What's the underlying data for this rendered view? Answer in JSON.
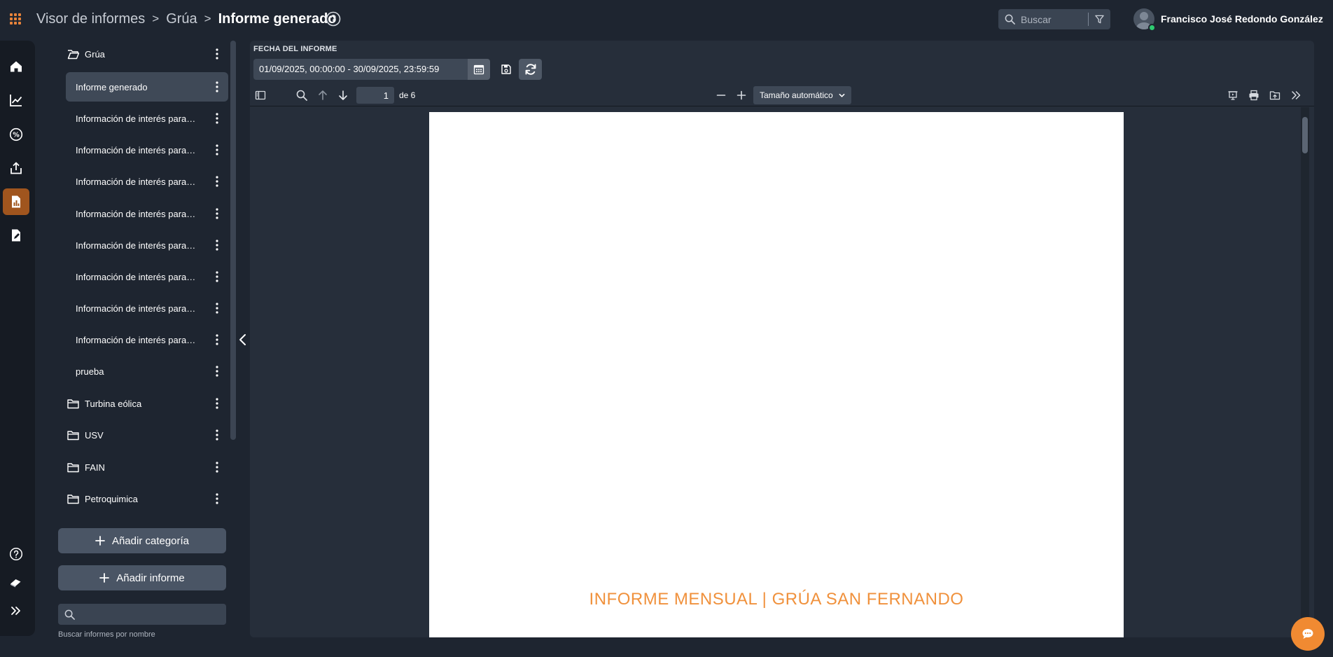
{
  "header": {
    "breadcrumb": [
      "Visor de informes",
      "Grúa",
      "Informe generado"
    ],
    "breadcrumb_separator": ">",
    "search_placeholder": "Buscar",
    "user_name": "Francisco José Redondo González"
  },
  "rail": {
    "active_index": 4,
    "icons": [
      "home-icon",
      "line-chart-icon",
      "percent-icon",
      "export-icon",
      "report-icon",
      "edit-document-icon"
    ],
    "bottom_icons": [
      "help-icon",
      "eraser-icon",
      "expand-rail-icon"
    ]
  },
  "tree": {
    "items": [
      {
        "label": "Grúa",
        "kind": "category",
        "open": true
      },
      {
        "label": "Informe generado",
        "kind": "report",
        "active": true
      },
      {
        "label": "Información de interés para ...",
        "kind": "report"
      },
      {
        "label": "Información de interés para ...",
        "kind": "report"
      },
      {
        "label": "Información de interés para ...",
        "kind": "report"
      },
      {
        "label": "Información de interés para ...",
        "kind": "report"
      },
      {
        "label": "Información de interés para ...",
        "kind": "report"
      },
      {
        "label": "Información de interés para ...",
        "kind": "report"
      },
      {
        "label": "Información de interés para ...",
        "kind": "report"
      },
      {
        "label": "Información de interés para ...",
        "kind": "report"
      },
      {
        "label": "prueba",
        "kind": "report"
      },
      {
        "label": "Turbina eólica",
        "kind": "category"
      },
      {
        "label": "USV",
        "kind": "category"
      },
      {
        "label": "FAIN",
        "kind": "category"
      },
      {
        "label": "Petroquimica",
        "kind": "category"
      }
    ],
    "add_category_label": "Añadir categoría",
    "add_report_label": "Añadir informe",
    "search_hint": "Buscar informes por nombre"
  },
  "viewer": {
    "date_label": "FECHA DEL INFORME",
    "date_range": "01/09/2025, 00:00:00 - 30/09/2025, 23:59:59",
    "page_current": "1",
    "page_total": "de 6",
    "zoom_label": "Tamaño automático",
    "cover_title": "INFORME MENSUAL | GRÚA SAN FERNANDO"
  },
  "colors": {
    "accent": "#f08a32",
    "rail_active": "#a0551e",
    "online": "#2ecc71"
  }
}
